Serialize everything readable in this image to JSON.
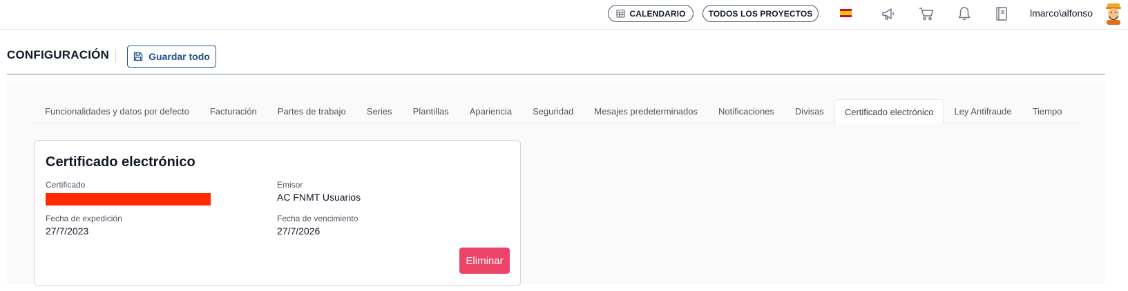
{
  "topbar": {
    "calendar_label": "CALENDARIO",
    "projects_label": "TODOS LOS PROYECTOS",
    "language_flag": "es-flag-icon",
    "icons": [
      "megaphone-icon",
      "cart-icon",
      "bell-icon",
      "book-icon"
    ],
    "username": "lmarco\\alfonso"
  },
  "header": {
    "title": "CONFIGURACIÓN",
    "save_label": "Guardar todo"
  },
  "tabs": [
    {
      "label": "Funcionalidades y datos por defecto",
      "active": false
    },
    {
      "label": "Facturación",
      "active": false
    },
    {
      "label": "Partes de trabajo",
      "active": false
    },
    {
      "label": "Series",
      "active": false
    },
    {
      "label": "Plantillas",
      "active": false
    },
    {
      "label": "Apariencia",
      "active": false
    },
    {
      "label": "Seguridad",
      "active": false
    },
    {
      "label": "Mesajes predeterminados",
      "active": false
    },
    {
      "label": "Notificaciones",
      "active": false
    },
    {
      "label": "Divisas",
      "active": false
    },
    {
      "label": "Certificado electrónico",
      "active": true
    },
    {
      "label": "Ley Antifraude",
      "active": false
    },
    {
      "label": "Tiempo",
      "active": false
    }
  ],
  "certificate": {
    "title": "Certificado electrónico",
    "certificate_label": "Certificado",
    "certificate_value": "",
    "issuer_label": "Emisor",
    "issuer_value": "AC FNMT Usuarios",
    "issue_date_label": "Fecha de expedición",
    "issue_date_value": "27/7/2023",
    "expiry_date_label": "Fecha de vencimiento",
    "expiry_date_value": "27/7/2026",
    "delete_label": "Eliminar"
  },
  "colors": {
    "accent": "#1e4e86",
    "delete": "#ec4468",
    "redaction": "#ff2a00"
  }
}
